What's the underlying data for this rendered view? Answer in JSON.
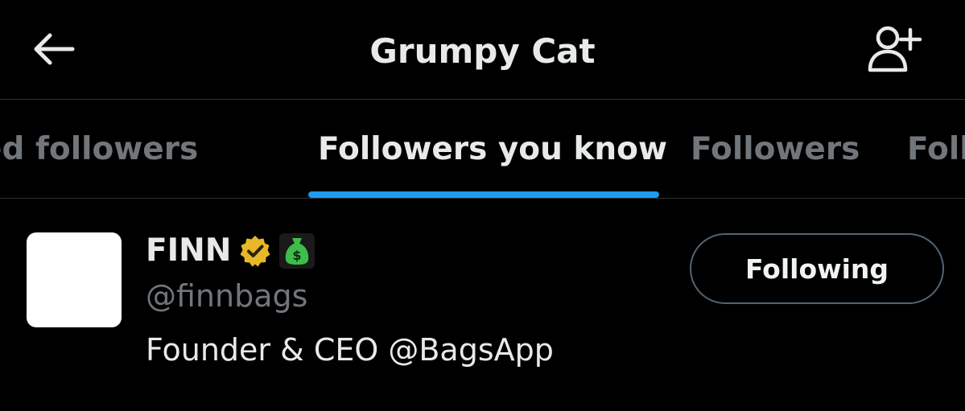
{
  "header": {
    "title": "Grumpy Cat",
    "back_icon": "arrow-left-icon",
    "add_user_icon": "person-plus-icon"
  },
  "tabs": [
    {
      "label": "Verified followers",
      "active": false
    },
    {
      "label": "Followers you know",
      "active": true
    },
    {
      "label": "Followers",
      "active": false
    },
    {
      "label": "Following",
      "active": false
    }
  ],
  "user": {
    "display_name": "FINN",
    "verified_badge_icon": "gold-verified-badge-icon",
    "affiliate_badge_icon": "money-bag-icon",
    "handle": "@finnbags",
    "bio": "Founder & CEO @BagsApp",
    "follow_button_label": "Following"
  },
  "colors": {
    "background": "#000000",
    "primary_text": "#e7e9ea",
    "secondary_text": "#71767b",
    "accent": "#1d9bf0",
    "divider": "#2f3336",
    "verified_gold": "#e8b829",
    "bag_green": "#3ebd4a"
  }
}
